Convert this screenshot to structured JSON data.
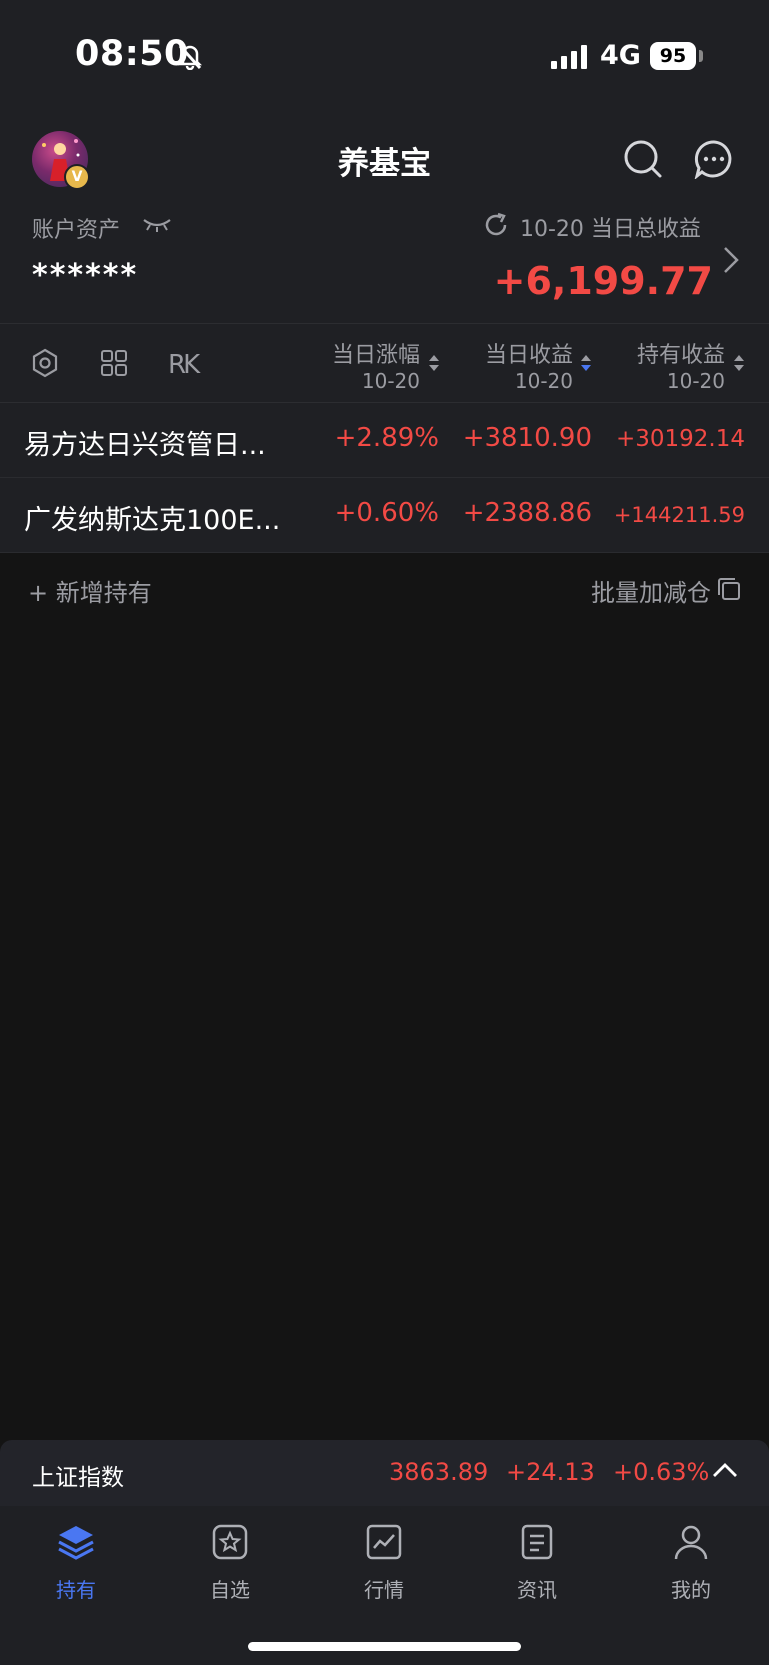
{
  "status_bar": {
    "time": "08:50",
    "network": "4G",
    "battery": "95"
  },
  "header": {
    "title": "养基宝",
    "avatar_badge": "V"
  },
  "account": {
    "label": "账户资产",
    "value_masked": "******",
    "date_label": "10-20 当日总收益",
    "total_daily_gain": "+6,199.77"
  },
  "columns": [
    {
      "title": "当日涨幅",
      "date": "10-20"
    },
    {
      "title": "当日收益",
      "date": "10-20"
    },
    {
      "title": "持有收益",
      "date": "10-20"
    }
  ],
  "toolbar_icons": [
    "settings-icon",
    "grid-icon",
    "rk-icon"
  ],
  "toolbar": {
    "rk_label": "RK"
  },
  "funds": [
    {
      "name": "易方达日兴资管日...",
      "daily_change": "+2.89%",
      "daily_gain": "+3810.90",
      "holding_gain": "+30192.14"
    },
    {
      "name": "广发纳斯达克100E...",
      "daily_change": "+0.60%",
      "daily_gain": "+2388.86",
      "holding_gain": "+144211.59"
    }
  ],
  "actions": {
    "add_holding": "+ 新增持有",
    "batch_adjust": "批量加减仓"
  },
  "index_bar": {
    "name": "上证指数",
    "value": "3863.89",
    "change": "+24.13",
    "change_pct": "+0.63%"
  },
  "tabs": [
    {
      "label": "持有",
      "icon": "layers-icon",
      "active": true
    },
    {
      "label": "自选",
      "icon": "star-icon",
      "active": false
    },
    {
      "label": "行情",
      "icon": "chart-icon",
      "active": false
    },
    {
      "label": "资讯",
      "icon": "news-icon",
      "active": false
    },
    {
      "label": "我的",
      "icon": "user-icon",
      "active": false
    }
  ],
  "colors": {
    "positive": "#f24a45",
    "accent": "#4a77f2",
    "background": "#141414",
    "panel": "#1f2024"
  }
}
